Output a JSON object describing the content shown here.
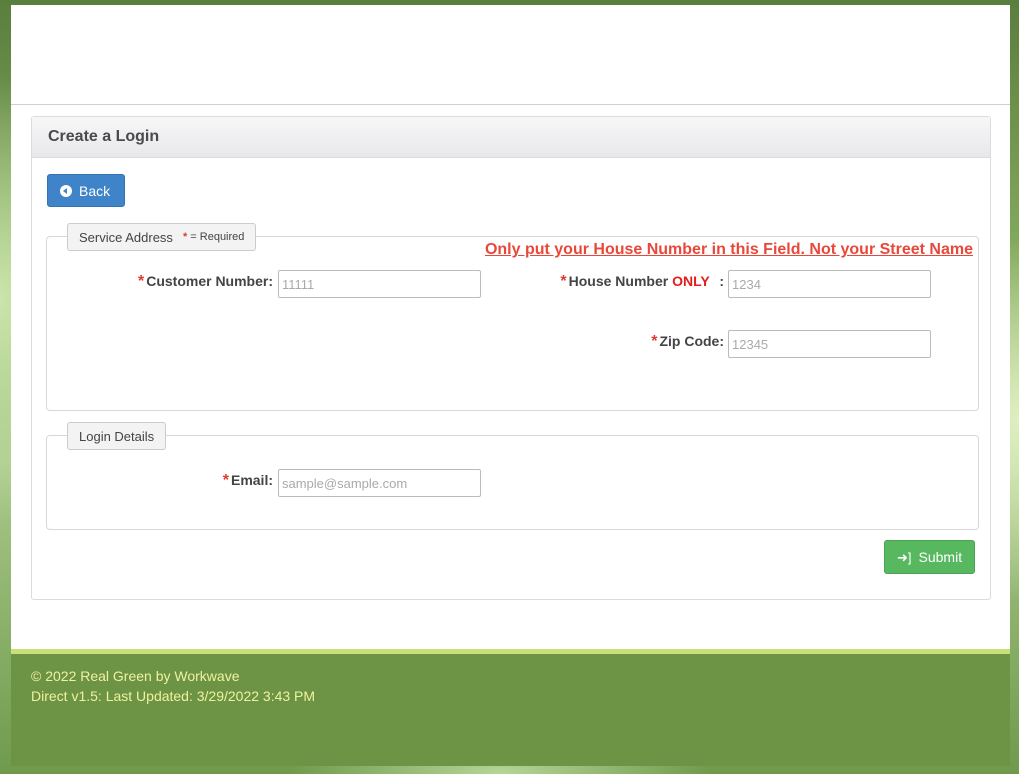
{
  "form": {
    "title": "Create a Login",
    "back_label": "Back",
    "submit_label": "Submit"
  },
  "service_address": {
    "legend": "Service Address",
    "required_star": "*",
    "required_note": "= Required",
    "warning": "Only put your House Number in this Field. Not your Street Name",
    "customer_number": {
      "star": "*",
      "label": "Customer Number:",
      "value": "",
      "placeholder": "11111"
    },
    "house_number": {
      "star": "*",
      "label": "House Number",
      "emphasis": "ONLY",
      "suffix": ":",
      "value": "",
      "placeholder": "1234"
    },
    "zip_code": {
      "star": "*",
      "label": "Zip Code:",
      "value": "",
      "placeholder": "12345"
    }
  },
  "login_details": {
    "legend": "Login Details",
    "email": {
      "star": "*",
      "label": "Email:",
      "value": "",
      "placeholder": "sample@sample.com"
    }
  },
  "footer": {
    "copyright": "© 2022 Real Green by Workwave",
    "version": "Direct v1.5: Last Updated: 3/29/2022 3:43 PM"
  },
  "colors": {
    "back_button": "#3f83c9",
    "submit_button": "#58b860",
    "required": "#e03b2e",
    "warning": "#e8483a",
    "footer_bg": "#6d9444",
    "footer_text": "#eef2a0"
  },
  "icons": {
    "back": "circle-arrow-left-icon",
    "submit": "sign-in-icon"
  }
}
